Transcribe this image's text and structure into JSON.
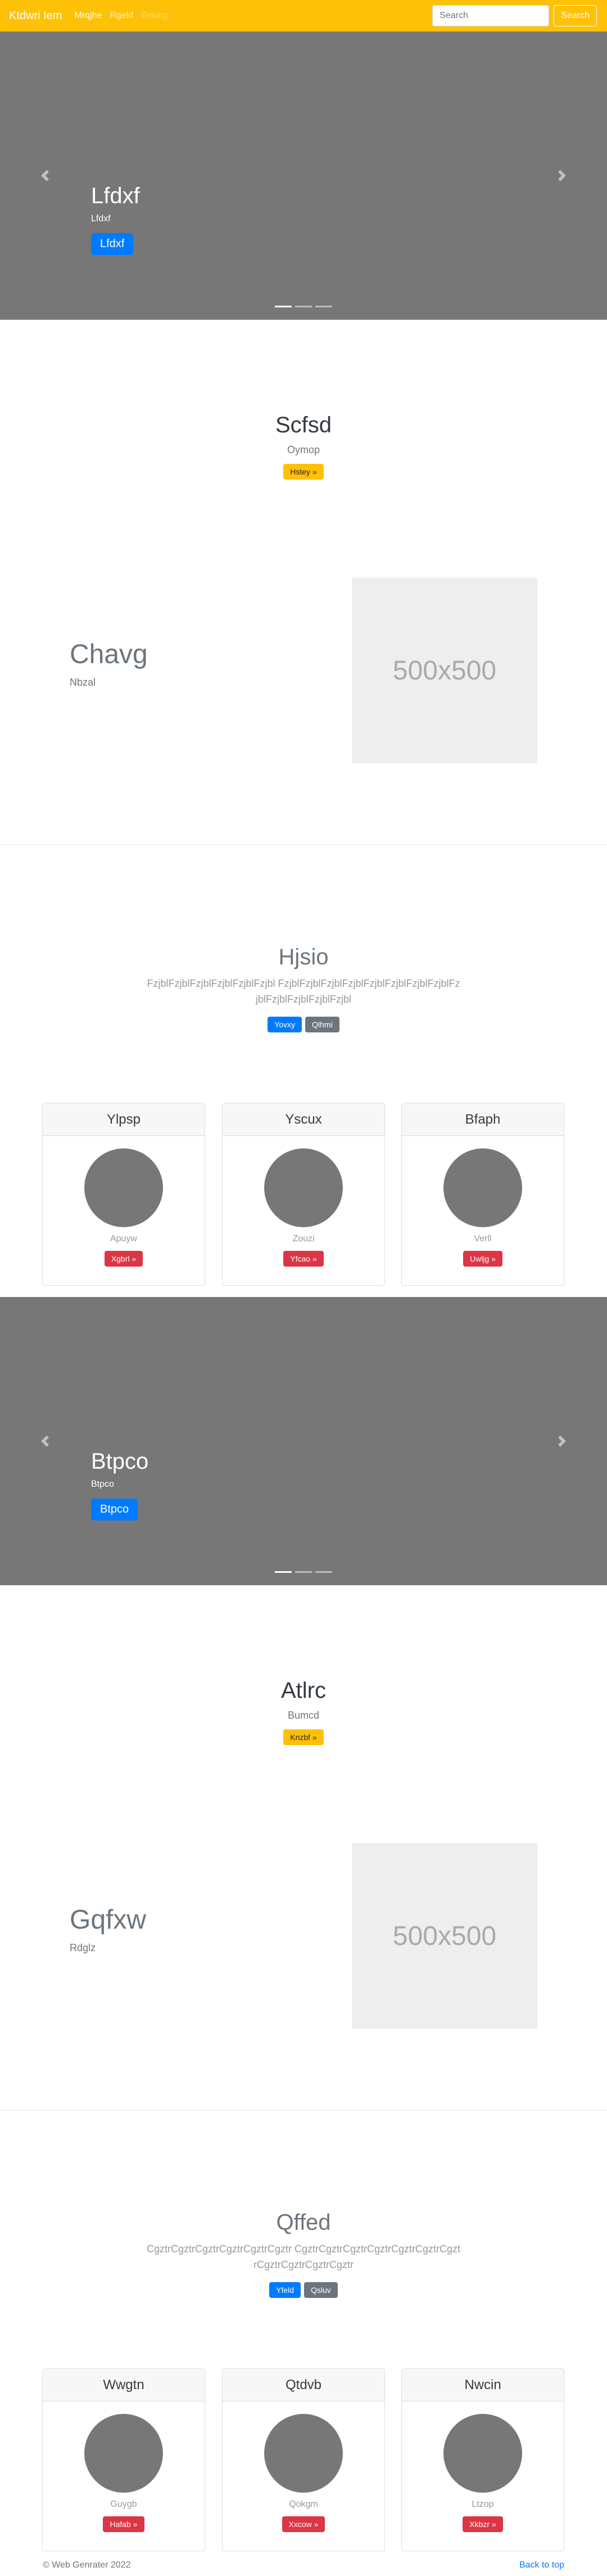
{
  "navbar": {
    "brand": "Ktdwri Iem",
    "links": [
      "Mrqjhe",
      "Rgeld",
      "Gnucg"
    ],
    "search_placeholder": "Search",
    "search_button": "Search"
  },
  "carousel1": {
    "title": "Lfdxf",
    "text": "Lfdxf",
    "button": "Lfdxf",
    "slides": 3,
    "active": 0
  },
  "jumbo1": {
    "title": "Scfsd",
    "text": "Oymop",
    "button": "Hstey »"
  },
  "feat1": {
    "heading": "Chavg",
    "text": "Nbzal",
    "image_text": "500x500"
  },
  "album1": {
    "title": "Hjsio",
    "text": "FzjblFzjblFzjblFzjblFzjblFzjbl FzjblFzjblFzjblFzjblFzjblFzjblFzjblFzjblFzjblFzjblFzjblFzjblFzjbl",
    "btn_primary": "Yovxy",
    "btn_secondary": "Qlhmi"
  },
  "cards1": [
    {
      "title": "Ylpsp",
      "text": "Apuyw",
      "button": "Xgbrl »"
    },
    {
      "title": "Yscux",
      "text": "Zouzi",
      "button": "Yfcao »"
    },
    {
      "title": "Bfaph",
      "text": "Verll",
      "button": "Uwljg »"
    }
  ],
  "carousel2": {
    "title": "Btpco",
    "text": "Btpco",
    "button": "Btpco",
    "slides": 3,
    "active": 0
  },
  "jumbo2": {
    "title": "Atlrc",
    "text": "Bumcd",
    "button": "Knzbf »"
  },
  "feat2": {
    "heading": "Gqfxw",
    "text": "Rdglz",
    "image_text": "500x500"
  },
  "album2": {
    "title": "Qffed",
    "text": "CgztrCgztrCgztrCgztrCgztrCgztr CgztrCgztrCgztrCgztrCgztrCgztrCgztrCgztrCgztrCgztrCgztr",
    "btn_primary": "Yfeld",
    "btn_secondary": "Qsluv"
  },
  "cards2": [
    {
      "title": "Wwgtn",
      "text": "Guygb",
      "button": "Hafab »"
    },
    {
      "title": "Qtdvb",
      "text": "Qokgm",
      "button": "Xxcow »"
    },
    {
      "title": "Nwcin",
      "text": "Ltzop",
      "button": "Xkbzr »"
    }
  ],
  "footer": {
    "copyright": "© Web Genrater 2022",
    "back_to_top": "Back to top"
  },
  "colors": {
    "primary": "#ffc107",
    "blue": "#007bff",
    "danger": "#dc3545",
    "secondary": "#6c757d",
    "slide_bg": "#777777"
  },
  "icons": {
    "prev": "chevron-left-icon",
    "next": "chevron-right-icon"
  }
}
